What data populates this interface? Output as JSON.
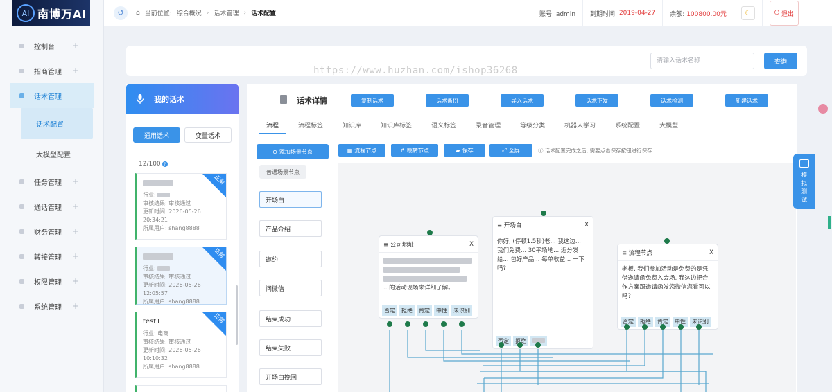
{
  "brand": {
    "name": "南博万AI",
    "mark": "AI"
  },
  "sidebar": {
    "items": [
      {
        "label": "控制台"
      },
      {
        "label": "招商管理"
      },
      {
        "label": "话术管理",
        "active": true
      },
      {
        "label": "任务管理"
      },
      {
        "label": "通话管理"
      },
      {
        "label": "财务管理"
      },
      {
        "label": "转接管理"
      },
      {
        "label": "权限管理"
      },
      {
        "label": "系统管理"
      }
    ],
    "subitems": [
      {
        "label": "话术配置",
        "active": true
      },
      {
        "label": "大模型配置"
      }
    ]
  },
  "header": {
    "crumb_prefix": "当前位置:",
    "crumb_1": "综合概况",
    "crumb_2": "话术管理",
    "crumb_3": "话术配置",
    "account": "账号: admin",
    "expiry_label": "到期时间:",
    "expiry_value": "2019-04-27",
    "balance_label": "余额:",
    "balance_value": "100800.00元",
    "logout": "退出"
  },
  "search": {
    "placeholder": "请输入话术名称",
    "button": "查询"
  },
  "watermark": "https://www.huzhan.com/ishop36268",
  "my_scripts": {
    "title": "我的话术",
    "tab_general": "通用话术",
    "tab_variable": "变量话术",
    "quota": "12/100",
    "ribbon": "正常",
    "cards": [
      {
        "name": "",
        "industry": "行业:",
        "review": "审核结果: 审核通过",
        "updated": "更新时间: 2026-05-26 20:34:21",
        "user": "所属用户: shang8888"
      },
      {
        "name": "",
        "industry": "行业:",
        "review": "审核结果: 审核通过",
        "updated": "更新时间: 2026-05-26 12:05:57",
        "user": "所属用户: shang8888"
      },
      {
        "name": "test1",
        "industry": "行业: 电商",
        "review": "审核结果: 审核通过",
        "updated": "更新时间: 2026-05-26 10:10:32",
        "user": "所属用户: shang8888"
      }
    ]
  },
  "detail": {
    "title": "话术详情",
    "buttons": [
      "复制话术",
      "话术备份",
      "导入话术",
      "话术下发",
      "话术检测",
      "新建话术"
    ],
    "tabs": [
      "流程",
      "流程标签",
      "知识库",
      "知识库标签",
      "语义标签",
      "录音管理",
      "等级分类",
      "机器人学习",
      "系统配置",
      "大模型"
    ],
    "add_scene": "添加场景节点",
    "scene_label": "普通场景节点",
    "scenes": [
      "开场白",
      "产品介绍",
      "邀约",
      "问微信",
      "结束成功",
      "结束失败",
      "开场白挽回"
    ],
    "tools": {
      "flow": "流程节点",
      "jump": "跳转节点",
      "save": "保存",
      "full": "全屏"
    },
    "tip": "话术配置完成之后, 需要点击保存按钮进行保存"
  },
  "flow": {
    "close": "X",
    "node1": {
      "title": "公司地址",
      "text": "...的活动现场来详细了解。",
      "opts": [
        "否定",
        "拒绝",
        "肯定",
        "中性",
        "未识别"
      ]
    },
    "node2": {
      "title": "开场白",
      "text": "你好, (停顿1.5秒)老... 我这边... 我们免费... 30平场地... 近分发给... 包好产品... 每单收益... 一下吗?",
      "opts": [
        "否定",
        "拒绝"
      ]
    },
    "node3": {
      "title": "流程节点",
      "text": "老板, 我们参加活动是免费的是凭借邀请函免费入会场, 我这边把合作方案跟邀请函发您微信您看可以吗?",
      "opts": [
        "否定",
        "拒绝",
        "肯定",
        "中性",
        "未识别"
      ]
    }
  },
  "float_test": [
    "模",
    "拟",
    "测",
    "试"
  ],
  "colors": {
    "primary": "#3a93e8",
    "danger": "#e23b3b",
    "success": "#41b36b",
    "port": "#1e7a4a",
    "edge": "#5aa8cf"
  }
}
